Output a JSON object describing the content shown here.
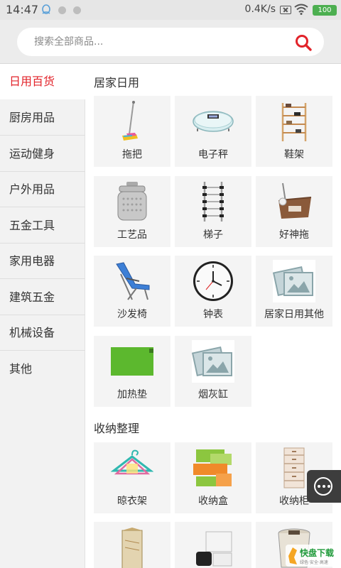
{
  "status_bar": {
    "time": "14:47",
    "net_speed": "0.4K/s",
    "battery": "100"
  },
  "search": {
    "placeholder": "搜索全部商品..."
  },
  "sidebar": {
    "items": [
      {
        "label": "日用百货",
        "active": true
      },
      {
        "label": "厨房用品"
      },
      {
        "label": "运动健身"
      },
      {
        "label": "户外用品"
      },
      {
        "label": "五金工具"
      },
      {
        "label": "家用电器"
      },
      {
        "label": "建筑五金"
      },
      {
        "label": "机械设备"
      },
      {
        "label": "其他"
      }
    ]
  },
  "sections": [
    {
      "title": "居家日用",
      "products": [
        {
          "label": "拖把",
          "icon": "mop-icon"
        },
        {
          "label": "电子秤",
          "icon": "scale-icon"
        },
        {
          "label": "鞋架",
          "icon": "shoe-rack-icon"
        },
        {
          "label": "工艺品",
          "icon": "canister-icon"
        },
        {
          "label": "梯子",
          "icon": "ladder-icon"
        },
        {
          "label": "好神拖",
          "icon": "spin-mop-icon"
        },
        {
          "label": "沙发椅",
          "icon": "lounge-chair-icon"
        },
        {
          "label": "钟表",
          "icon": "clock-icon"
        },
        {
          "label": "居家日用其他",
          "icon": "placeholder-image-icon"
        },
        {
          "label": "加热垫",
          "icon": "heating-pad-icon"
        },
        {
          "label": "烟灰缸",
          "icon": "placeholder-image-icon"
        }
      ]
    },
    {
      "title": "收纳整理",
      "products": [
        {
          "label": "晾衣架",
          "icon": "hanger-icon"
        },
        {
          "label": "收纳盒",
          "icon": "storage-box-icon"
        },
        {
          "label": "收纳柜",
          "icon": "storage-cabinet-icon"
        },
        {
          "label": "",
          "icon": "wardrobe-icon"
        },
        {
          "label": "",
          "icon": "vacuum-bag-icon"
        },
        {
          "label": "",
          "icon": "bucket-icon"
        }
      ]
    }
  ],
  "watermark": {
    "text": "快盘下载"
  }
}
